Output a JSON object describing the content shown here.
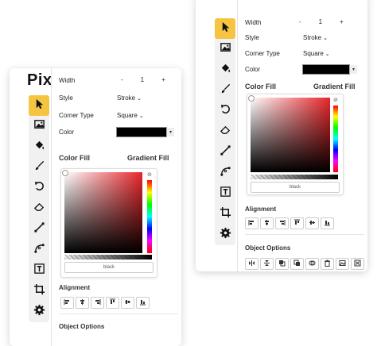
{
  "app": {
    "logo": "Pix"
  },
  "toolbar": {
    "tools": [
      {
        "icon": "cursor-icon",
        "active": true
      },
      {
        "icon": "image-icon",
        "active": false
      },
      {
        "icon": "fill-bucket-icon",
        "active": false
      },
      {
        "icon": "brush-icon",
        "active": false
      },
      {
        "icon": "undo-icon",
        "active": false
      },
      {
        "icon": "eraser-icon",
        "active": false
      },
      {
        "icon": "line-icon",
        "active": false
      },
      {
        "icon": "curve-icon",
        "active": false
      },
      {
        "icon": "text-icon",
        "active": false
      },
      {
        "icon": "crop-icon",
        "active": false
      },
      {
        "icon": "gear-icon",
        "active": false
      }
    ]
  },
  "props": {
    "width_label": "Width",
    "width_minus": "-",
    "width_value": "1",
    "width_plus": "+",
    "style_label": "Style",
    "style_value": "Stroke",
    "corner_label": "Corner Type",
    "corner_value": "Square",
    "color_label": "Color",
    "color_value": "#000000"
  },
  "fill": {
    "color_fill": "Color Fill",
    "gradient_fill": "Gradient Fill",
    "hex_value": "black",
    "base_hue": "#e8262b"
  },
  "alignment": {
    "label": "Alignment"
  },
  "object_options": {
    "label": "Object Options"
  }
}
